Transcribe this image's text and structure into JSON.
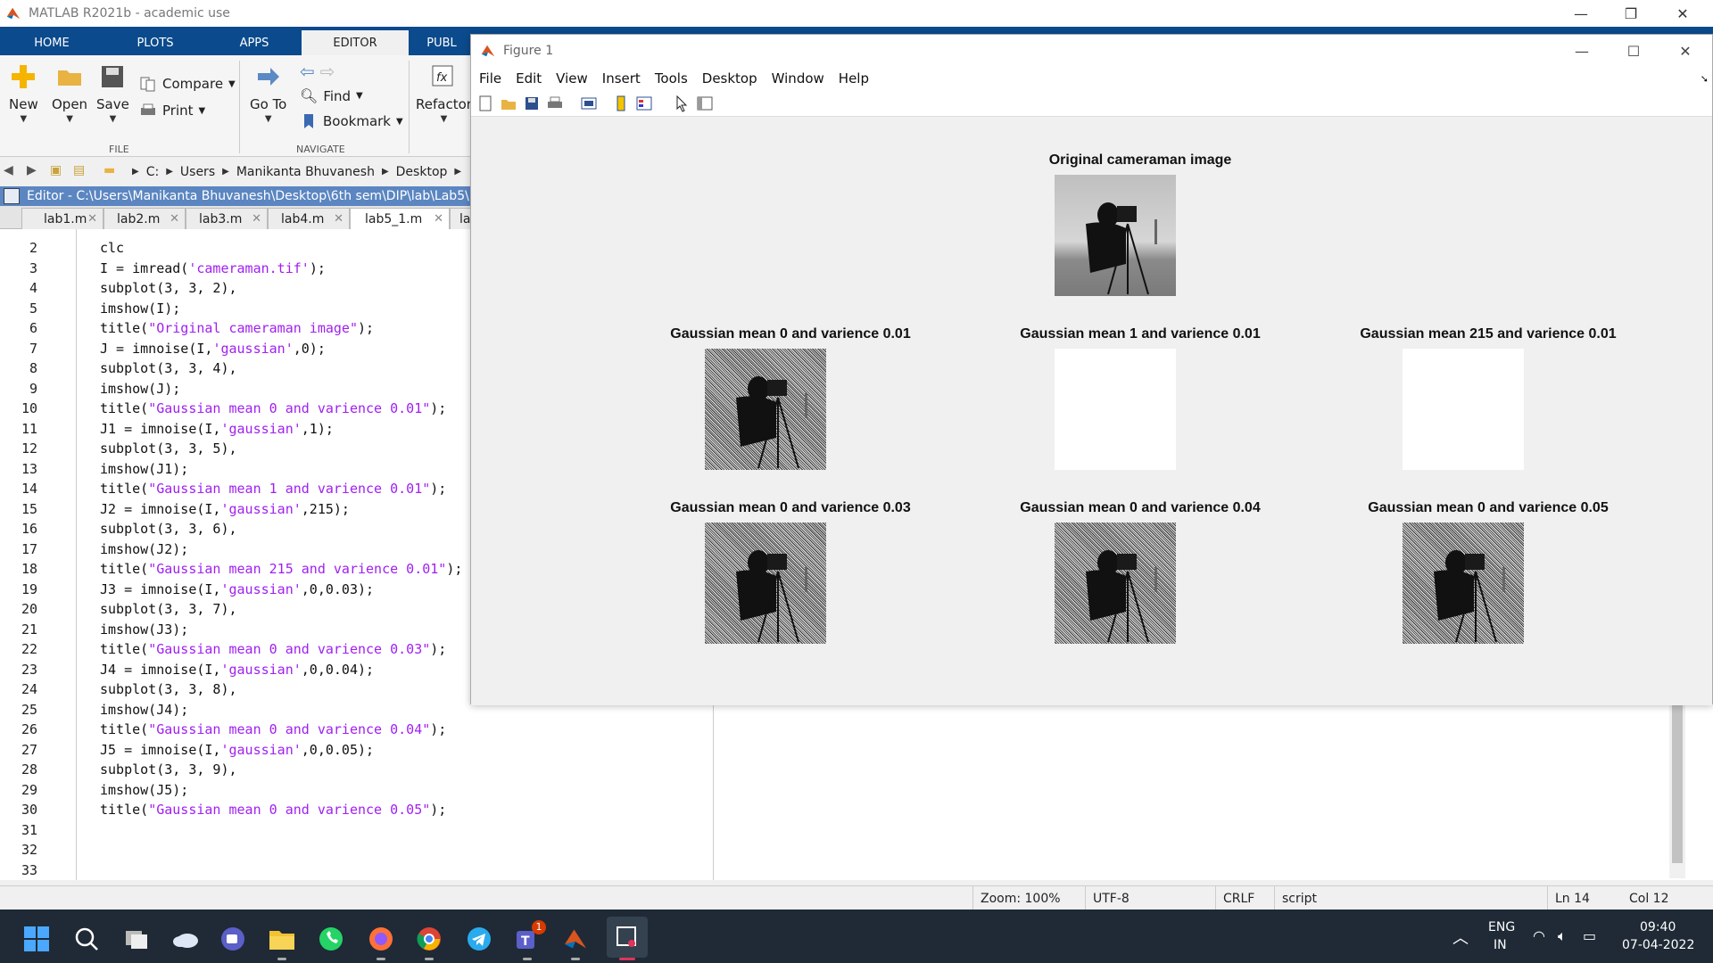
{
  "app": {
    "title": "MATLAB R2021b - academic use"
  },
  "ribbon_tabs": [
    "HOME",
    "PLOTS",
    "APPS",
    "EDITOR",
    "PUBL"
  ],
  "ribbon": {
    "new": "New",
    "open": "Open",
    "save": "Save",
    "compare": "Compare",
    "print": "Print",
    "goto": "Go To",
    "find": "Find",
    "bookmark": "Bookmark",
    "refactor": "Refactor",
    "file_section": "FILE",
    "navigate_section": "NAVIGATE"
  },
  "address": [
    "C:",
    "Users",
    "Manikanta Bhuvanesh",
    "Desktop"
  ],
  "editor": {
    "title": "Editor - C:\\Users\\Manikanta Bhuvanesh\\Desktop\\6th sem\\DIP\\lab\\Lab5\\lab",
    "tabs": [
      {
        "label": "lab1.m"
      },
      {
        "label": "lab2.m"
      },
      {
        "label": "lab3.m"
      },
      {
        "label": "lab4.m"
      },
      {
        "label": "lab5_1.m"
      },
      {
        "label": "la"
      }
    ],
    "lines": [
      {
        "n": "2",
        "code": "clc"
      },
      {
        "n": "3",
        "code": "I = imread('cameraman.tif');"
      },
      {
        "n": "4",
        "code": "subplot(3, 3, 2),"
      },
      {
        "n": "5",
        "code": "imshow(I);"
      },
      {
        "n": "6",
        "code": "title(\"Original cameraman image\");"
      },
      {
        "n": "7",
        "code": "J = imnoise(I,'gaussian',0);"
      },
      {
        "n": "8",
        "code": "subplot(3, 3, 4),"
      },
      {
        "n": "9",
        "code": "imshow(J);"
      },
      {
        "n": "10",
        "code": "title(\"Gaussian mean 0 and varience 0.01\");"
      },
      {
        "n": "11",
        "code": "J1 = imnoise(I,'gaussian',1);"
      },
      {
        "n": "12",
        "code": "subplot(3, 3, 5),"
      },
      {
        "n": "13",
        "code": "imshow(J1);"
      },
      {
        "n": "14",
        "code": "title(\"Gaussian mean 1 and varience 0.01\");"
      },
      {
        "n": "15",
        "code": "J2 = imnoise(I,'gaussian',215);"
      },
      {
        "n": "16",
        "code": "subplot(3, 3, 6),"
      },
      {
        "n": "17",
        "code": "imshow(J2);"
      },
      {
        "n": "18",
        "code": "title(\"Gaussian mean 215 and varience 0.01\");"
      },
      {
        "n": "19",
        "code": "J3 = imnoise(I,'gaussian',0,0.03);"
      },
      {
        "n": "20",
        "code": "subplot(3, 3, 7),"
      },
      {
        "n": "21",
        "code": "imshow(J3);"
      },
      {
        "n": "22",
        "code": "title(\"Gaussian mean 0 and varience 0.03\");"
      },
      {
        "n": "23",
        "code": "J4 = imnoise(I,'gaussian',0,0.04);"
      },
      {
        "n": "24",
        "code": "subplot(3, 3, 8),"
      },
      {
        "n": "25",
        "code": "imshow(J4);"
      },
      {
        "n": "26",
        "code": "title(\"Gaussian mean 0 and varience 0.04\");"
      },
      {
        "n": "27",
        "code": "J5 = imnoise(I,'gaussian',0,0.05);"
      },
      {
        "n": "28",
        "code": "subplot(3, 3, 9),"
      },
      {
        "n": "29",
        "code": "imshow(J5);"
      },
      {
        "n": "30",
        "code": "title(\"Gaussian mean 0 and varience 0.05\");"
      },
      {
        "n": "31",
        "code": ""
      },
      {
        "n": "32",
        "code": ""
      },
      {
        "n": "33",
        "code": ""
      }
    ]
  },
  "status": {
    "zoom": "Zoom: 100%",
    "encoding": "UTF-8",
    "eol": "CRLF",
    "type": "script",
    "ln": "Ln  14",
    "col": "Col  12"
  },
  "figure": {
    "title": "Figure 1",
    "menu": [
      "File",
      "Edit",
      "View",
      "Insert",
      "Tools",
      "Desktop",
      "Window",
      "Help"
    ],
    "subplots": [
      {
        "title": "Original cameraman image",
        "noise": "none"
      },
      {
        "title": "Gaussian mean 0 and varience 0.01",
        "noise": "low"
      },
      {
        "title": "Gaussian mean 1 and varience 0.01",
        "noise": "white_faint"
      },
      {
        "title": "Gaussian mean 215 and varience 0.01",
        "noise": "white"
      },
      {
        "title": "Gaussian mean 0 and varience 0.03",
        "noise": "mid"
      },
      {
        "title": "Gaussian mean 0 and varience 0.04",
        "noise": "mid2"
      },
      {
        "title": "Gaussian mean 0 and varience 0.05",
        "noise": "high"
      }
    ]
  },
  "taskbar": {
    "lang1": "ENG",
    "lang2": "IN",
    "time": "09:40",
    "date": "07-04-2022",
    "teams_badge": "1"
  },
  "colors": {
    "ribbon_tab_bar": "#0b4a8c",
    "editor_title_bar": "#5b86c1",
    "string": "#a020f0",
    "taskbar": "#1f2a36"
  }
}
